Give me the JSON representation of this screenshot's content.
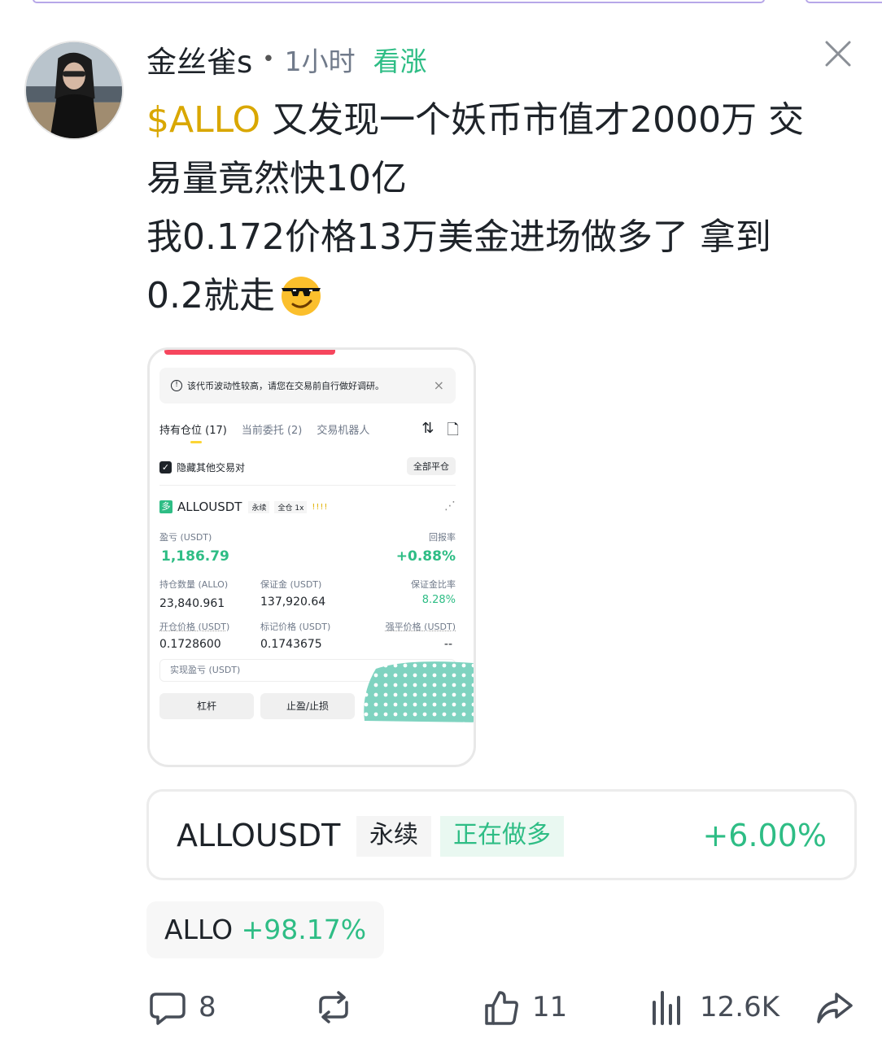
{
  "post": {
    "username": "金丝雀s",
    "separator": "•",
    "time": "1小时",
    "sentiment": "看涨",
    "cashtag": "$ALLO",
    "line1_rest": " 又发现一个妖币市值才2000万 交",
    "line2": "易量竟然快10亿",
    "line3": "我0.172价格13万美金进场做多了 拿到",
    "line4": "0.2就走"
  },
  "screenshot": {
    "notice": "该代币波动性较高，请您在交易前自行做好调研。",
    "tabs": [
      "持有仓位 (17)",
      "当前委托 (2)",
      "交易机器人"
    ],
    "hide_other": "隐藏其他交易对",
    "close_all": "全部平仓",
    "long_tag": "多",
    "pair": "ALLOUSDT",
    "perp_chip": "永续",
    "margin_chip": "全仓 1x",
    "pnl_label": "盈亏 (USDT)",
    "pnl_value": "1,186.79",
    "roi_label": "回报率",
    "roi_value": "+0.88%",
    "size_label": "持仓数量 (ALLO)",
    "size_value": "23,840.961",
    "margin_label": "保证金 (USDT)",
    "margin_value": "137,920.64",
    "margin_ratio_label": "保证金比率",
    "margin_ratio_value": "8.28%",
    "entry_label": "开仓价格 (USDT)",
    "entry_value": "0.1728600",
    "mark_label": "标记价格 (USDT)",
    "mark_value": "0.1743675",
    "liq_label": "强平价格 (USDT)",
    "liq_value": "--",
    "realized_label": "实现盈亏 (USDT)",
    "btn_leverage": "杠杆",
    "btn_tpsl": "止盈/止损"
  },
  "position_card": {
    "pair": "ALLOUSDT",
    "type": "永续",
    "status": "正在做多",
    "change": "+6.00%"
  },
  "coin_chip": {
    "symbol": "ALLO",
    "change": "+98.17%"
  },
  "actions": {
    "comments": "8",
    "likes": "11",
    "views": "12.6K"
  },
  "colors": {
    "green": "#2ebd85",
    "cashtag": "#d9a700",
    "red": "#f6465d"
  }
}
